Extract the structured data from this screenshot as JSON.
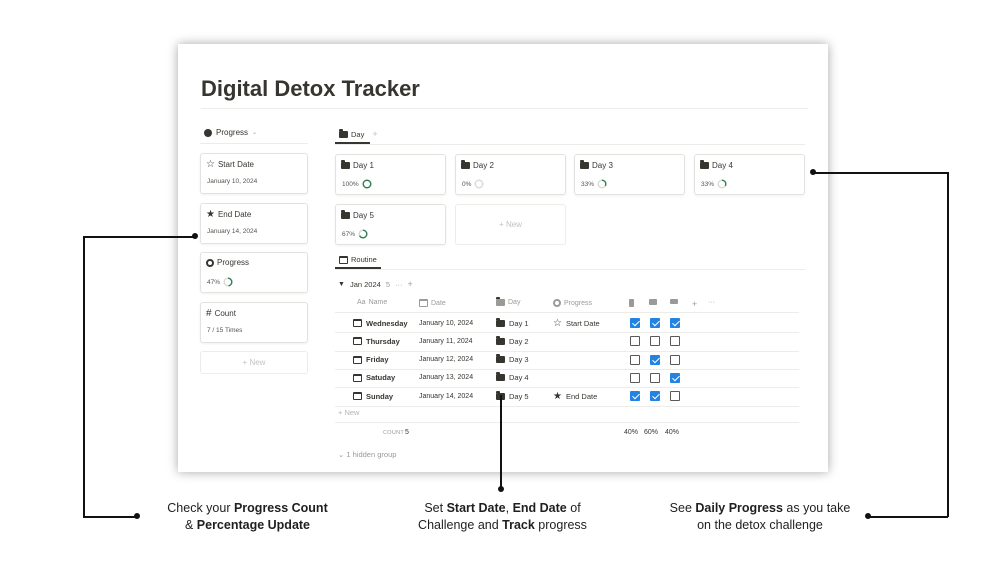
{
  "page": {
    "title": "Digital Detox Tracker"
  },
  "left": {
    "header": "Progress",
    "cards": [
      {
        "icon": "star-outline-icon",
        "glyph": "☆",
        "title": "Start Date",
        "value": "January 10, 2024"
      },
      {
        "icon": "star-icon",
        "glyph": "★",
        "title": "End Date",
        "value": "January 14, 2024"
      },
      {
        "icon": "gear-icon",
        "glyph": "",
        "title": "Progress",
        "value": "47%",
        "ring_fraction": 0.47
      },
      {
        "icon": "hash-icon",
        "glyph": "#",
        "title": "Count",
        "value": "7 / 15 Times"
      }
    ],
    "new_label": "+ New"
  },
  "gallery": {
    "tab": "Day",
    "tab_add": "+",
    "cards": [
      {
        "title": "Day 1",
        "pct": "100%",
        "fraction": 1.0
      },
      {
        "title": "Day 2",
        "pct": "0%",
        "fraction": 0.0
      },
      {
        "title": "Day 3",
        "pct": "33%",
        "fraction": 0.33
      },
      {
        "title": "Day 4",
        "pct": "33%",
        "fraction": 0.33
      },
      {
        "title": "Day 5",
        "pct": "67%",
        "fraction": 0.67
      }
    ],
    "new_label": "+ New"
  },
  "table": {
    "tab": "Routine",
    "group": {
      "label": "Jan 2024",
      "count": "5",
      "more": "···",
      "add": "+"
    },
    "headers": {
      "name": "Name",
      "date": "Date",
      "day": "Day",
      "progress": "Progress",
      "add": "+",
      "more": "···"
    },
    "rows": [
      {
        "name": "Wednesday",
        "date": "January 10, 2024",
        "day": "Day 1",
        "progress": "Start Date",
        "progress_icon": "star-outline-icon",
        "checks": [
          true,
          true,
          true
        ]
      },
      {
        "name": "Thursday",
        "date": "January 11, 2024",
        "day": "Day 2",
        "progress": "",
        "progress_icon": "",
        "checks": [
          false,
          false,
          false
        ]
      },
      {
        "name": "Friday",
        "date": "January 12, 2024",
        "day": "Day 3",
        "progress": "",
        "progress_icon": "",
        "checks": [
          false,
          true,
          false
        ]
      },
      {
        "name": "Satuday",
        "date": "January 13, 2024",
        "day": "Day 4",
        "progress": "",
        "progress_icon": "",
        "checks": [
          false,
          false,
          true
        ]
      },
      {
        "name": "Sunday",
        "date": "January 14, 2024",
        "day": "Day 5",
        "progress": "End Date",
        "progress_icon": "star-icon",
        "checks": [
          true,
          true,
          false
        ]
      }
    ],
    "new_label": "+ New",
    "count_label": "COUNT",
    "count_value": "5",
    "percents": [
      "40%",
      "60%",
      "40%"
    ],
    "hidden_group": "1 hidden group"
  },
  "annotations": {
    "left": {
      "pre": "Check your ",
      "b1": "Progress Count",
      "mid": "& ",
      "b2": "Percentage Update"
    },
    "center": {
      "pre": "Set ",
      "b1": "Start Date",
      "sep": ", ",
      "b2": "End Date",
      "post1": " of",
      "line2pre": "Challenge and ",
      "b3": "Track",
      "post2": " progress"
    },
    "right": {
      "pre": "See ",
      "b1": "Daily Progress",
      "post1": " as you take",
      "line2": "on the detox challenge"
    }
  },
  "colors": {
    "checkbox": "#2383e2",
    "ring": "#2e7d4f",
    "ring_track": "#d9d8d4"
  }
}
